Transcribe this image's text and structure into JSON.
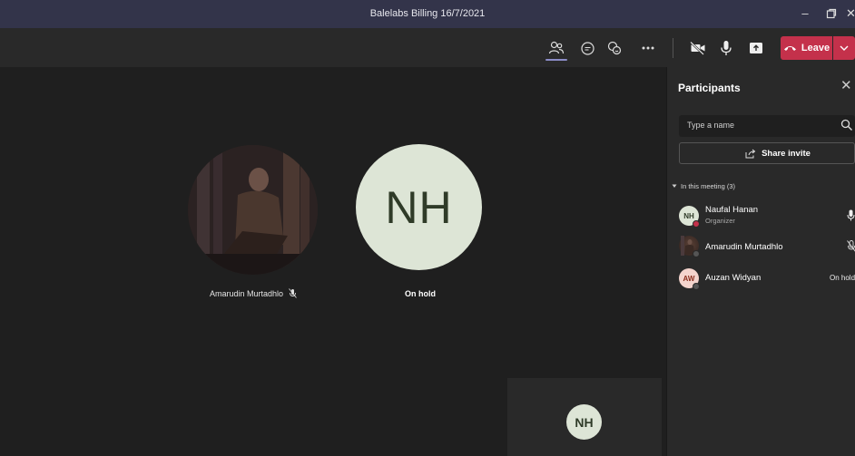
{
  "window": {
    "title": "Balelabs Billing 16/7/2021"
  },
  "toolbar": {
    "leave_label": "Leave"
  },
  "stage": {
    "participant_left_name": "Amarudin Murtadhlo",
    "participant_right_initials": "NH",
    "participant_right_label": "On hold",
    "self_initials": "NH"
  },
  "panel": {
    "title": "Participants",
    "search_placeholder": "Type a name",
    "share_label": "Share invite",
    "section_label": "In this meeting (3)",
    "participants": [
      {
        "initials": "NH",
        "name": "Naufal Hanan",
        "role": "Organizer",
        "status": ""
      },
      {
        "initials": "",
        "name": "Amarudin Murtadhlo",
        "role": "",
        "status": ""
      },
      {
        "initials": "AW",
        "name": "Auzan Widyan",
        "role": "",
        "status": "On hold"
      }
    ]
  },
  "colors": {
    "titlebar": "#33344a",
    "leave": "#c4314b",
    "accent": "#8b8cc7"
  }
}
